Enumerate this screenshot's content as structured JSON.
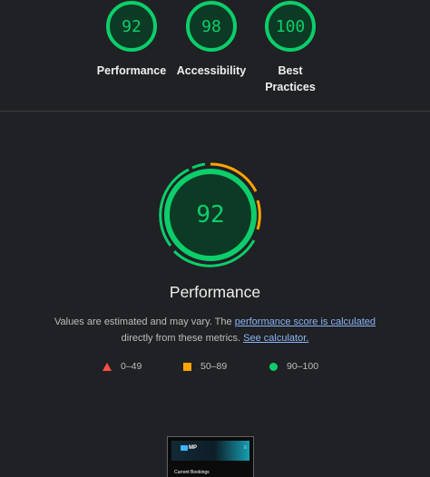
{
  "colors": {
    "background": "#202124",
    "pass": "#0cce6b",
    "average": "#ffa400",
    "fail": "#ff4e42",
    "link": "#8ab4f8"
  },
  "category_scores": [
    {
      "label": "Performance",
      "score": "92"
    },
    {
      "label": "Accessibility",
      "score": "98"
    },
    {
      "label": "Best Practices",
      "score": "100"
    }
  ],
  "performance": {
    "score": "92",
    "title": "Performance",
    "desc_prefix": "Values are estimated and may vary. The ",
    "desc_link1": "performance score is calculated",
    "desc_middle": " directly from these metrics. ",
    "desc_link2": "See calculator.",
    "gauge_icon_note": "metric arcs: green and orange segments"
  },
  "legend": [
    {
      "range": "0–49",
      "icon": "triangle-icon"
    },
    {
      "range": "50–89",
      "icon": "square-icon"
    },
    {
      "range": "90–100",
      "icon": "circle-icon"
    }
  ],
  "screenshot_thumbnail": {
    "logo_text": "MP",
    "menu_icon": "hamburger-icon",
    "caption": "Current Bookings"
  }
}
